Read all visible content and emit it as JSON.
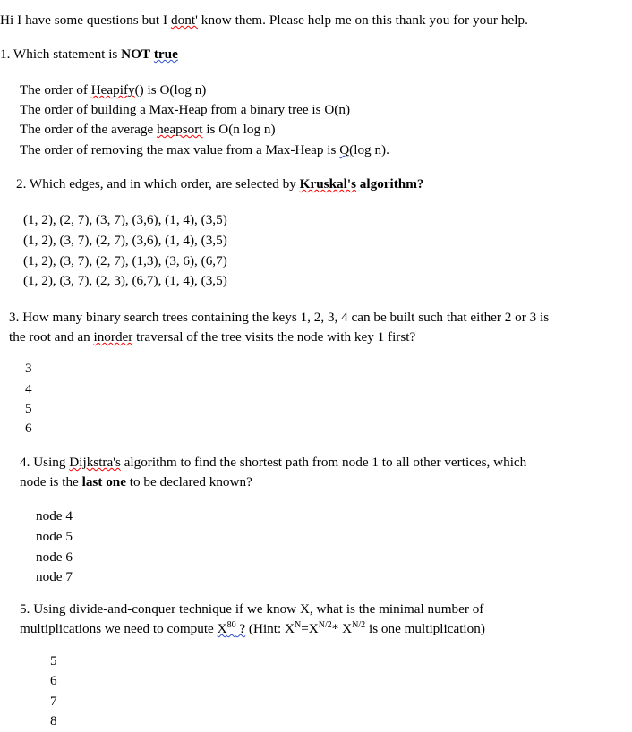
{
  "document": {
    "greeting": "Hi I have some questions but I dont' know them. Please help me on this thank you for your help.",
    "greeting_parts": {
      "before": "Hi I have some questions but I ",
      "misspelled": "dont'",
      "after": " know them. Please help me on this thank you for your help."
    },
    "questions": [
      {
        "number": "1.",
        "stem_before": " Which statement is ",
        "stem_bold_plain": "NOT",
        "stem_bold_underlined": "true",
        "options": [
          {
            "pre": "The order of ",
            "flagged": "Heapify",
            "post": "() is O(log n)"
          },
          {
            "pre": "The order of building a Max-Heap from a binary tree is O(n)",
            "flagged": "",
            "post": ""
          },
          {
            "pre": "The order of the average ",
            "flagged": "heapsort",
            "post": " is O(n log n)"
          },
          {
            "pre": "The order of removing the max value from a Max-Heap is ",
            "flagged": "Q(",
            "post": "log n)."
          }
        ]
      },
      {
        "number": "2.",
        "stem_before": " Which edges, and in which order, are selected by ",
        "stem_bold_underlined": "Kruskal's",
        "stem_bold_plain": " algorithm?",
        "options": [
          "(1, 2), (2, 7), (3, 7), (3,6), (1, 4), (3,5)",
          "(1, 2), (3, 7), (2, 7), (3,6), (1, 4), (3,5)",
          "(1, 2), (3, 7), (2, 7), (1,3), (3, 6), (6,7)",
          "(1, 2), (3, 7), (2, 3), (6,7), (1, 4), (3,5)"
        ]
      },
      {
        "number": "3.",
        "stem_line1": " How many binary search trees containing the keys 1, 2, 3, 4 can be built such that either 2 or 3 is",
        "stem_line2_pre": "the root and an ",
        "stem_line2_flagged": "inorder",
        "stem_line2_post": " traversal of the tree visits the node with key 1 first?",
        "options": [
          "3",
          "4",
          "5",
          "6"
        ]
      },
      {
        "number": "4.",
        "stem_line1_pre": " Using ",
        "stem_line1_flagged": "Dijkstra's",
        "stem_line1_post": " algorithm to find the shortest path from node 1 to all other vertices, which",
        "stem_line2_pre": "node is the ",
        "stem_line2_bold": "last one",
        "stem_line2_post": " to be declared known?",
        "options": [
          "node 4",
          "node 5",
          "node 6",
          "node 7"
        ]
      },
      {
        "number": "5.",
        "stem_line1": " Using divide-and-conquer technique if we know X, what is the minimal number of",
        "stem_line2_pre": "multiplications we need to compute ",
        "stem_line2_formula_base": "X",
        "stem_line2_formula_exp": "80",
        "stem_line2_formula_tail": " ?",
        "stem_line2_hint_pre": " (Hint: X",
        "stem_line2_hint_exp1": "N",
        "stem_line2_hint_mid": "=X",
        "stem_line2_hint_exp2": "N/2",
        "stem_line2_hint_mid2": "* X",
        "stem_line2_hint_exp3": "N/2",
        "stem_line2_hint_post": " is one multiplication)",
        "options": [
          "5",
          "6",
          "7",
          "8"
        ]
      }
    ]
  },
  "colors": {
    "text": "#000000",
    "spellcheck_red": "#ff0000",
    "grammar_blue": "#2b4ecb",
    "page_background": "#ffffff"
  }
}
